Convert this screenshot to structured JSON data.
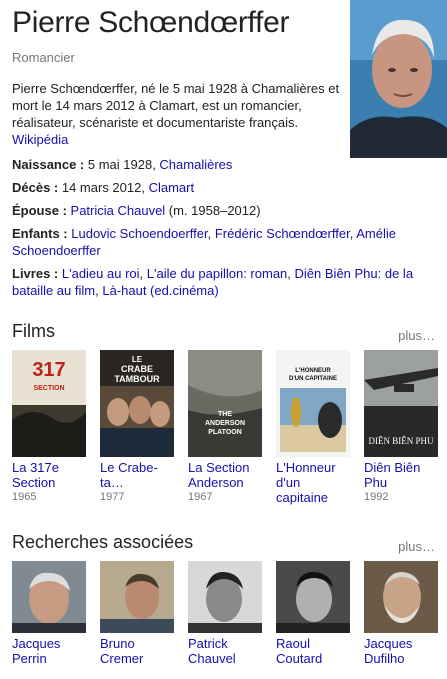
{
  "title": "Pierre Schœndœrffer",
  "subtitle": "Romancier",
  "description": "Pierre Schœndœrffer, né le 5 mai 1928 à Chamalières et mort le 14 mars 2012 à Clamart, est un romancier, réalisateur, scénariste et documentariste français.",
  "description_source": "Wikipédia",
  "facts": {
    "naissance": {
      "label": "Naissance :",
      "text": " 5 mai 1928, ",
      "link": "Chamalières"
    },
    "deces": {
      "label": "Décès :",
      "text": " 14 mars 2012, ",
      "link": "Clamart"
    },
    "epouse": {
      "label": "Épouse :",
      "link": "Patricia Chauvel",
      "suffix": " (m. 1958–2012)"
    },
    "enfants": {
      "label": "Enfants :",
      "links": [
        "Ludovic Schoendoerffer",
        "Frédéric Schœndœrffer",
        "Amélie Schoendoerffer"
      ]
    },
    "livres": {
      "label": "Livres :",
      "links": [
        "L'adieu au roi",
        "L'aile du papillon: roman",
        "Diên Biên Phu: de la bataille au film",
        "Là-haut (ed.cinéma)"
      ]
    }
  },
  "films": {
    "heading": "Films",
    "more": "plus…",
    "items": [
      {
        "name": "La 317e Section",
        "year": "1965",
        "poster_text": "317e SECTION"
      },
      {
        "name": "Le Crabe-ta…",
        "year": "1977",
        "poster_text": "LE CRABE TAMBOUR"
      },
      {
        "name": "La Section Anderson",
        "year": "1967",
        "poster_text": "THE ANDERSON PLATOON"
      },
      {
        "name": "L'Honneur d'un capitaine",
        "year": "",
        "poster_text": "L'HONNEUR D'UN CAPITAINE"
      },
      {
        "name": "Diên Biên Phu",
        "year": "1992",
        "poster_text": "DIÊN BIÊN PHU"
      }
    ]
  },
  "related": {
    "heading": "Recherches associées",
    "more": "plus…",
    "items": [
      {
        "name": "Jacques Perrin"
      },
      {
        "name": "Bruno Cremer"
      },
      {
        "name": "Patrick Chauvel"
      },
      {
        "name": "Raoul Coutard"
      },
      {
        "name": "Jacques Dufilho"
      }
    ]
  }
}
